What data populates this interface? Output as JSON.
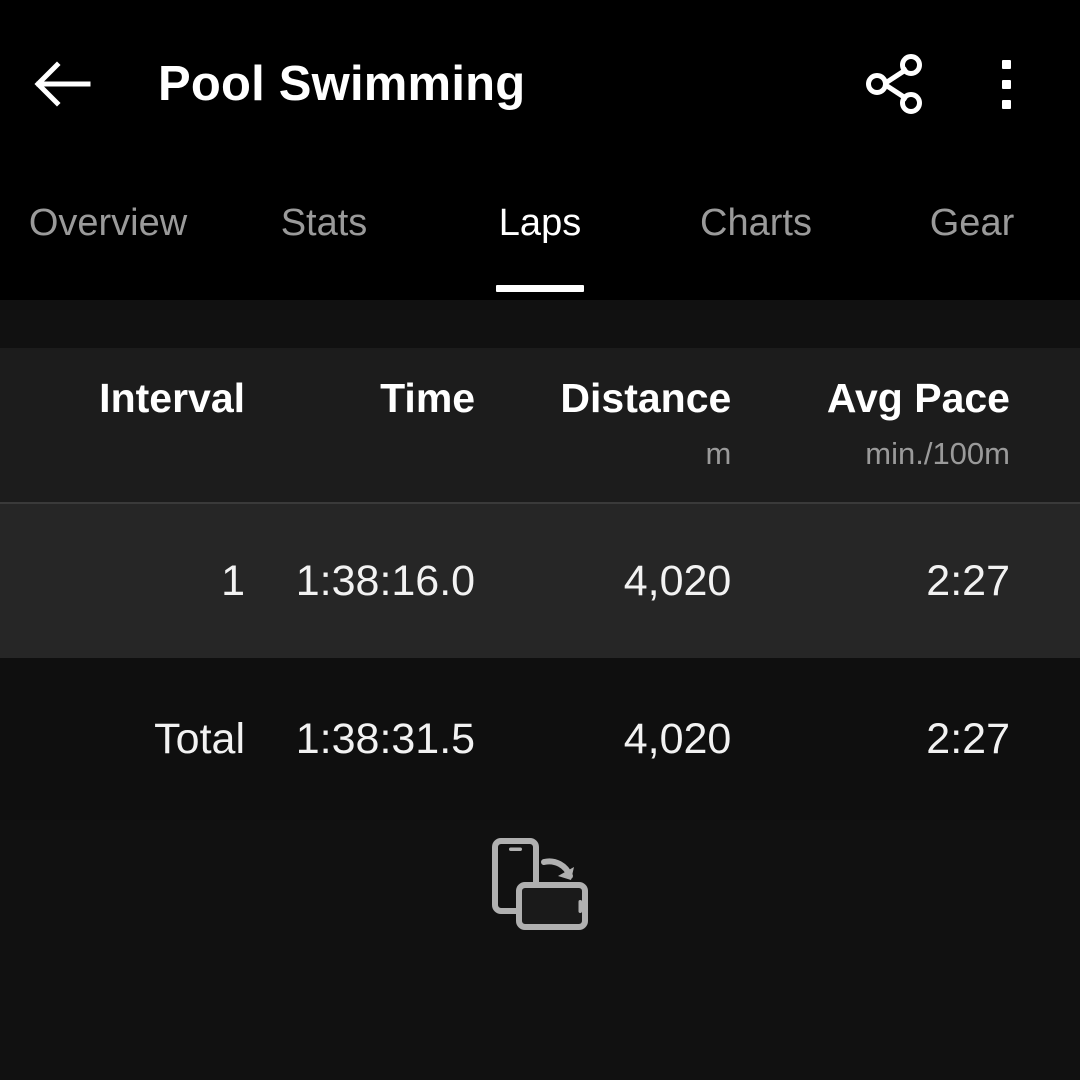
{
  "appbar": {
    "title": "Pool Swimming",
    "back_icon": "arrow-left-icon",
    "share_icon": "share-icon",
    "more_icon": "overflow-menu-icon"
  },
  "tabs": [
    {
      "label": "Overview",
      "active": false
    },
    {
      "label": "Stats",
      "active": false
    },
    {
      "label": "Laps",
      "active": true
    },
    {
      "label": "Charts",
      "active": false
    },
    {
      "label": "Gear",
      "active": false
    }
  ],
  "table": {
    "columns": [
      {
        "title": "Interval",
        "unit": ""
      },
      {
        "title": "Time",
        "unit": ""
      },
      {
        "title": "Distance",
        "unit": "m"
      },
      {
        "title": "Avg Pace",
        "unit": "min./100m"
      }
    ],
    "rows": [
      {
        "interval": "1",
        "time": "1:38:16.0",
        "distance": "4,020",
        "pace": "2:27"
      },
      {
        "interval": "Total",
        "time": "1:38:31.5",
        "distance": "4,020",
        "pace": "2:27"
      }
    ]
  },
  "rotate_hint": {
    "icon": "rotate-device-icon"
  },
  "colors": {
    "appbar_bg": "#000000",
    "page_bg": "#111111",
    "header_row_bg": "#1c1c1c",
    "lap_row_bg": "#262626",
    "total_row_bg": "#0f0f0f",
    "divider": "#3a3a3a",
    "text_primary": "#ffffff",
    "text_secondary": "#9a9a9a",
    "icon_muted": "#b0b0b0"
  }
}
